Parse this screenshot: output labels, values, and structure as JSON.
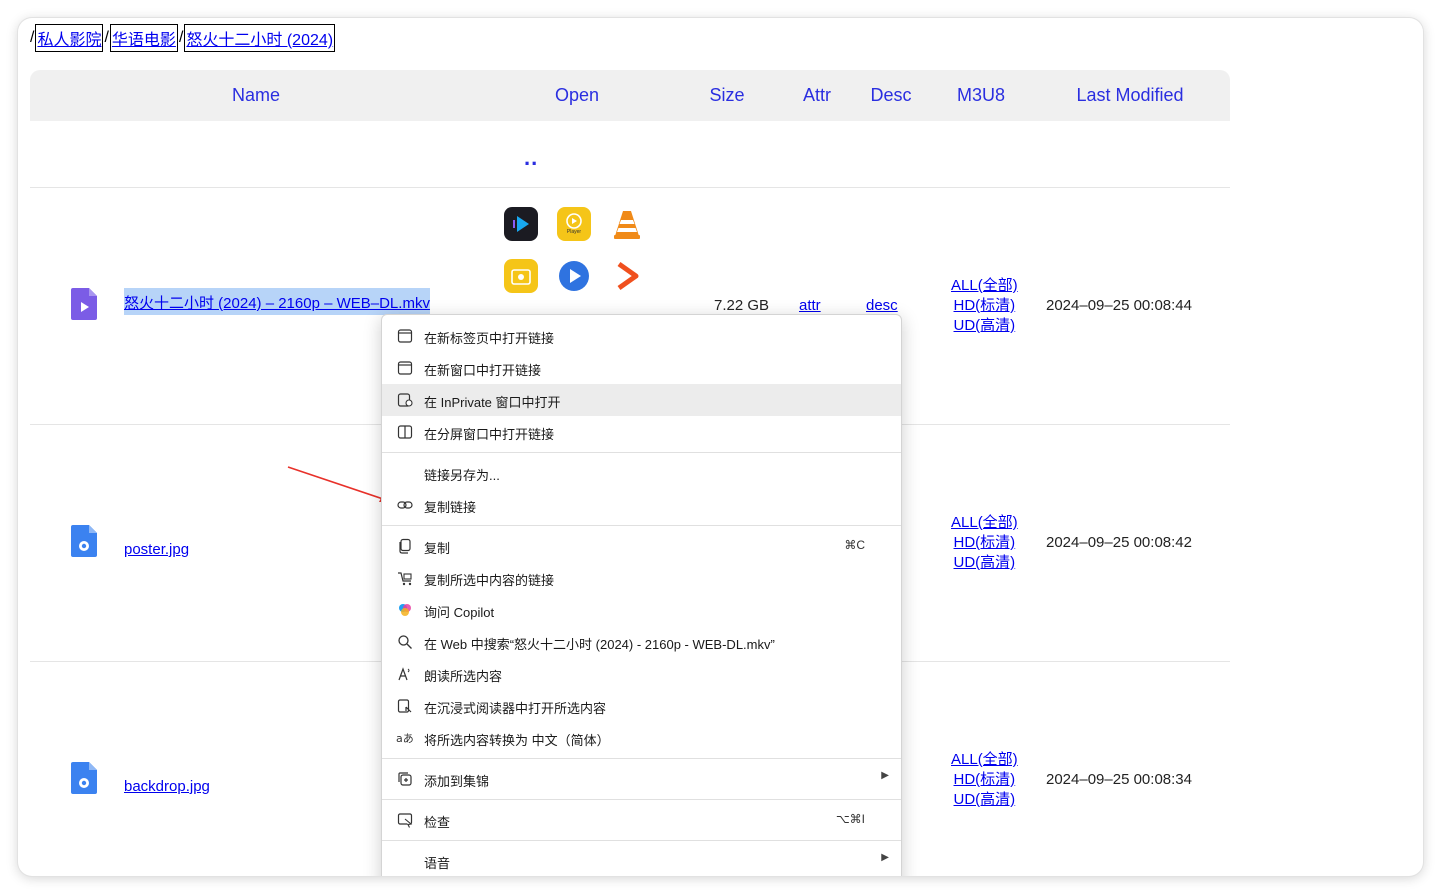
{
  "breadcrumb": {
    "root": "/",
    "items": [
      "私人影院",
      "华语电影",
      "怒火十二小时 (2024)"
    ],
    "sep": "/"
  },
  "table": {
    "headers": {
      "name": "Name",
      "open": "Open",
      "size": "Size",
      "attr": "Attr",
      "desc": "Desc",
      "m3u8": "M3U8",
      "modified": "Last Modified"
    },
    "parent_link": "..",
    "rows": [
      {
        "icon": "video-file-icon",
        "icon_tag": "MKV",
        "name": "怒火十二小时 (2024) – 2160p – WEB–DL.mkv",
        "size": "7.22 GB",
        "attr": "attr",
        "desc": "desc",
        "m3u8": [
          "ALL(全部)",
          "HD(标清)",
          "UD(高清)"
        ],
        "modified": "2024–09–25 00:08:44"
      },
      {
        "icon": "image-file-icon",
        "icon_tag": "JPG",
        "name": "poster.jpg",
        "m3u8": [
          "ALL(全部)",
          "HD(标清)",
          "UD(高清)"
        ],
        "modified": "2024–09–25 00:08:42"
      },
      {
        "icon": "image-file-icon",
        "icon_tag": "JPG",
        "name": "backdrop.jpg",
        "m3u8": [
          "ALL(全部)",
          "HD(标清)",
          "UD(高清)"
        ],
        "modified": "2024–09–25 00:08:34"
      }
    ],
    "player_icons": [
      "infuse-icon",
      "player-icon",
      "vlc-icon",
      "folder-player-icon",
      "play-circle-icon",
      "media-player-icon"
    ],
    "player_tag": "Player"
  },
  "context_menu": {
    "items": [
      {
        "icon": "new-tab-icon",
        "label": "在新标签页中打开链接"
      },
      {
        "icon": "new-window-icon",
        "label": "在新窗口中打开链接"
      },
      {
        "icon": "inprivate-icon",
        "label": "在 InPrivate 窗口中打开",
        "highlighted": true
      },
      {
        "icon": "split-screen-icon",
        "label": "在分屏窗口中打开链接"
      },
      {
        "icon": "",
        "label": "链接另存为..."
      },
      {
        "icon": "link-icon",
        "label": "复制链接"
      },
      {
        "icon": "copy-icon",
        "label": "复制",
        "shortcut": "⌘C"
      },
      {
        "icon": "copy-link-selection-icon",
        "label": "复制所选中内容的链接"
      },
      {
        "icon": "copilot-icon",
        "label": "询问 Copilot"
      },
      {
        "icon": "search-icon",
        "label": "在 Web 中搜索“怒火十二小时 (2024) - 2160p - WEB-DL.mkv”"
      },
      {
        "icon": "read-aloud-icon",
        "label": "朗读所选内容"
      },
      {
        "icon": "immersive-reader-icon",
        "label": "在沉浸式阅读器中打开所选内容"
      },
      {
        "icon": "translate-icon",
        "label": "将所选内容转换为 中文（简体）"
      },
      {
        "icon": "collections-icon",
        "label": "添加到集锦",
        "submenu": true
      },
      {
        "icon": "inspect-icon",
        "label": "检查",
        "shortcut": "⌥⌘I"
      },
      {
        "icon": "",
        "label": "语音",
        "submenu": true
      }
    ]
  },
  "colors": {
    "link": "#0000ee",
    "header_text": "#2a2ee0",
    "selection": "#b7d4f8",
    "annotation_arrow": "#e8312a"
  }
}
